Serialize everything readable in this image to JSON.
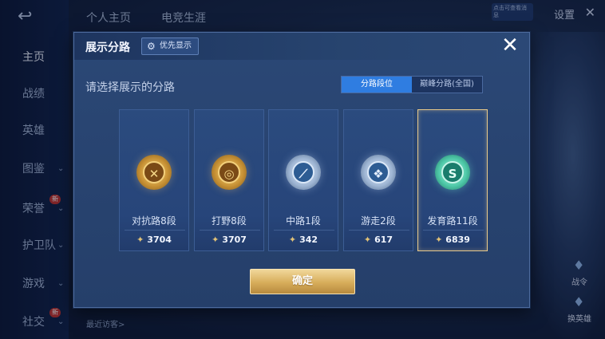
{
  "background": {
    "top_tabs": [
      "个人主页",
      "电竞生涯"
    ],
    "nav_items": [
      {
        "label": "主页",
        "active": true
      },
      {
        "label": "战绩"
      },
      {
        "label": "英雄"
      },
      {
        "label": "图鉴",
        "chevron": true
      },
      {
        "label": "荣誉",
        "chevron": true,
        "badge": "新"
      },
      {
        "label": "护卫队",
        "chevron": true
      },
      {
        "label": "游戏",
        "chevron": true
      },
      {
        "label": "社交",
        "chevron": true,
        "badge": "新"
      }
    ],
    "settings_label": "设置",
    "notice_text": "点击可查看消息",
    "visitor_label": "最近访客>",
    "right_button_1": "战令",
    "right_button_2": "换英雄"
  },
  "modal": {
    "title": "展示分路",
    "priority_button": "优先显示",
    "subtitle": "请选择展示的分路",
    "segment_tabs": [
      {
        "label": "分路段位",
        "active": true
      },
      {
        "label": "巅峰分路(全国)",
        "active": false
      }
    ],
    "cards": [
      {
        "label": "对抗路8段",
        "score": "3704",
        "emblem": "gold",
        "emblem_icon": "sword-icon",
        "glyph": "✕"
      },
      {
        "label": "打野8段",
        "score": "3707",
        "emblem": "gold",
        "emblem_icon": "dragon-icon",
        "glyph": "◎"
      },
      {
        "label": "中路1段",
        "score": "342",
        "emblem": "silver",
        "emblem_icon": "staff-icon",
        "glyph": "⟋"
      },
      {
        "label": "游走2段",
        "score": "617",
        "emblem": "silver",
        "emblem_icon": "wings-icon",
        "glyph": "❖"
      },
      {
        "label": "发育路11段",
        "score": "6839",
        "emblem": "jade",
        "emblem_icon": "bow-icon",
        "glyph": "S",
        "selected": true
      }
    ],
    "confirm_button": "确定"
  },
  "colors": {
    "accent_blue": "#2f7de1",
    "gold_button": "#d7ad5a",
    "selected_border": "#e8c98a"
  }
}
